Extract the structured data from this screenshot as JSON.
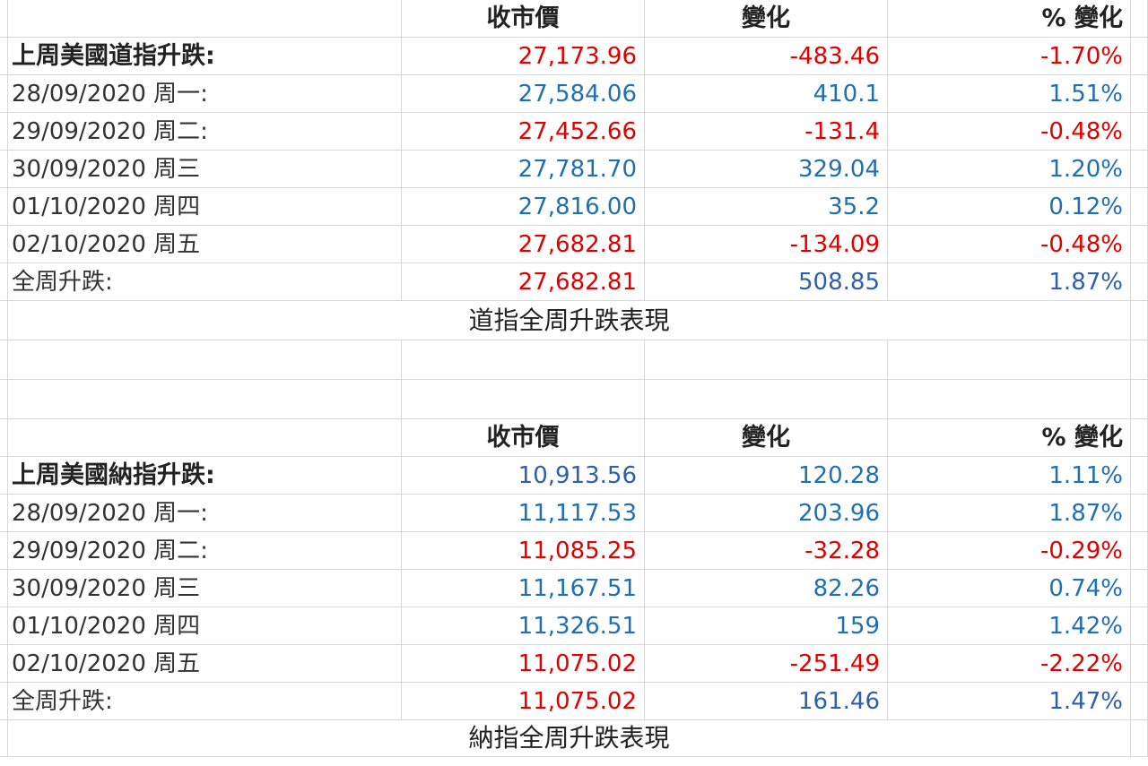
{
  "colors": {
    "red": "#e00000",
    "blue": "#1f6fb2",
    "gridline": "#d9d9d9"
  },
  "headers": {
    "close": "收市價",
    "change": "變化",
    "pct": "% 變化"
  },
  "dow": {
    "title": "上周美國道指升跌:",
    "summary": {
      "close": "27,173.96",
      "change": "-483.46",
      "pct": "-1.70%"
    },
    "rows": [
      {
        "label": "28/09/2020 周一:",
        "close": "27,584.06",
        "change": "410.1",
        "pct": "1.51%"
      },
      {
        "label": "29/09/2020 周二:",
        "close": "27,452.66",
        "change": "-131.4",
        "pct": "-0.48%"
      },
      {
        "label": "30/09/2020 周三",
        "close": "27,781.70",
        "change": "329.04",
        "pct": "1.20%"
      },
      {
        "label": "01/10/2020 周四",
        "close": "27,816.00",
        "change": "35.2",
        "pct": "0.12%"
      },
      {
        "label": "02/10/2020 周五",
        "close": "27,682.81",
        "change": "-134.09",
        "pct": "-0.48%"
      }
    ],
    "week": {
      "label": "全周升跌:",
      "close": "27,682.81",
      "change": "508.85",
      "pct": "1.87%"
    },
    "caption": "道指全周升跌表現"
  },
  "nasdaq": {
    "title": "上周美國納指升跌:",
    "summary": {
      "close": "10,913.56",
      "change": "120.28",
      "pct": "1.11%"
    },
    "rows": [
      {
        "label": "28/09/2020 周一:",
        "close": "11,117.53",
        "change": "203.96",
        "pct": "1.87%"
      },
      {
        "label": "29/09/2020 周二:",
        "close": "11,085.25",
        "change": "-32.28",
        "pct": "-0.29%"
      },
      {
        "label": "30/09/2020 周三",
        "close": "11,167.51",
        "change": "82.26",
        "pct": "0.74%"
      },
      {
        "label": "01/10/2020 周四",
        "close": "11,326.51",
        "change": "159",
        "pct": "1.42%"
      },
      {
        "label": "02/10/2020 周五",
        "close": "11,075.02",
        "change": "-251.49",
        "pct": "-2.22%"
      }
    ],
    "week": {
      "label": "全周升跌:",
      "close": "11,075.02",
      "change": "161.46",
      "pct": "1.47%"
    },
    "caption": "納指全周升跌表現"
  }
}
